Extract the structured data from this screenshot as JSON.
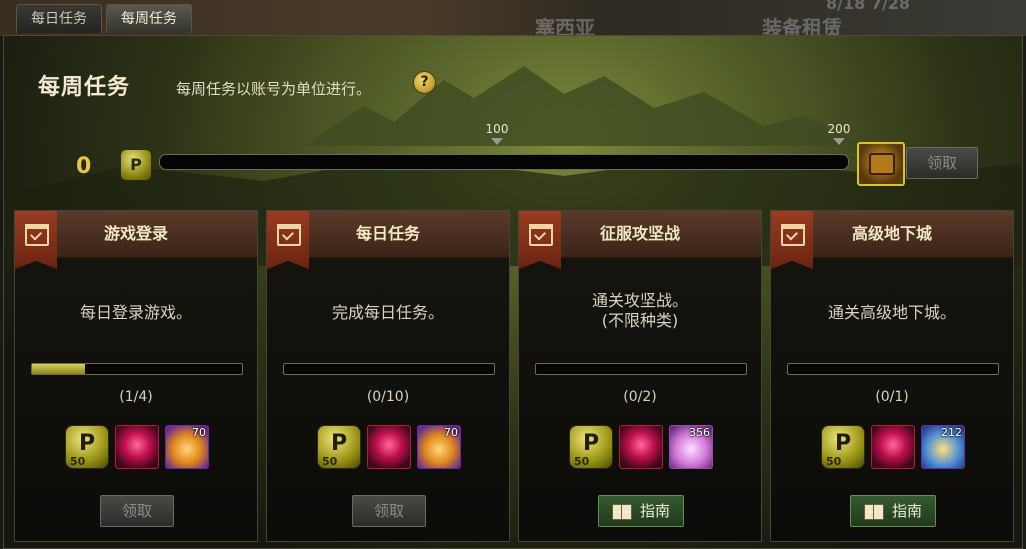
{
  "tabs": [
    {
      "label": "每日任务",
      "active": false
    },
    {
      "label": "每周任务",
      "active": true
    }
  ],
  "background": {
    "ghost_left": "塞西亚",
    "ghost_right": "装备租赁",
    "ghost_date": "8/18 7/28"
  },
  "header": {
    "title": "每周任务",
    "subtitle": "每周任务以账号为单位进行。",
    "help_icon": "question-icon"
  },
  "progress": {
    "points": "0",
    "icon_letter": "P",
    "markers": [
      "100",
      "200"
    ],
    "max": 200,
    "claim_label": "领取"
  },
  "missions": [
    {
      "title": "游戏登录",
      "desc": [
        "每日登录游戏。"
      ],
      "progress_text": "(1/4)",
      "progress": 0.25,
      "rewards": [
        {
          "type": "point",
          "letter": "P",
          "amount": "50"
        },
        {
          "type": "heart-gem"
        },
        {
          "type": "gold-crystal",
          "qty": "70"
        }
      ],
      "button": {
        "label": "领取",
        "kind": "claim"
      }
    },
    {
      "title": "每日任务",
      "desc": [
        "完成每日任务。"
      ],
      "progress_text": "(0/10)",
      "progress": 0,
      "rewards": [
        {
          "type": "point",
          "letter": "P",
          "amount": "50"
        },
        {
          "type": "heart-gem"
        },
        {
          "type": "gold-crystal",
          "qty": "70"
        }
      ],
      "button": {
        "label": "领取",
        "kind": "claim"
      }
    },
    {
      "title": "征服攻坚战",
      "desc": [
        "通关攻坚战。",
        "(不限种类)"
      ],
      "progress_text": "(0/2)",
      "progress": 0,
      "rewards": [
        {
          "type": "point",
          "letter": "P",
          "amount": "50"
        },
        {
          "type": "heart-gem"
        },
        {
          "type": "pink-crystal",
          "qty": "356"
        }
      ],
      "button": {
        "label": "指南",
        "kind": "guide"
      }
    },
    {
      "title": "高级地下城",
      "desc": [
        "通关高级地下城。"
      ],
      "progress_text": "(0/1)",
      "progress": 0,
      "rewards": [
        {
          "type": "point",
          "letter": "P",
          "amount": "50"
        },
        {
          "type": "heart-gem"
        },
        {
          "type": "star-box",
          "qty": "212"
        }
      ],
      "button": {
        "label": "指南",
        "kind": "guide"
      }
    }
  ]
}
